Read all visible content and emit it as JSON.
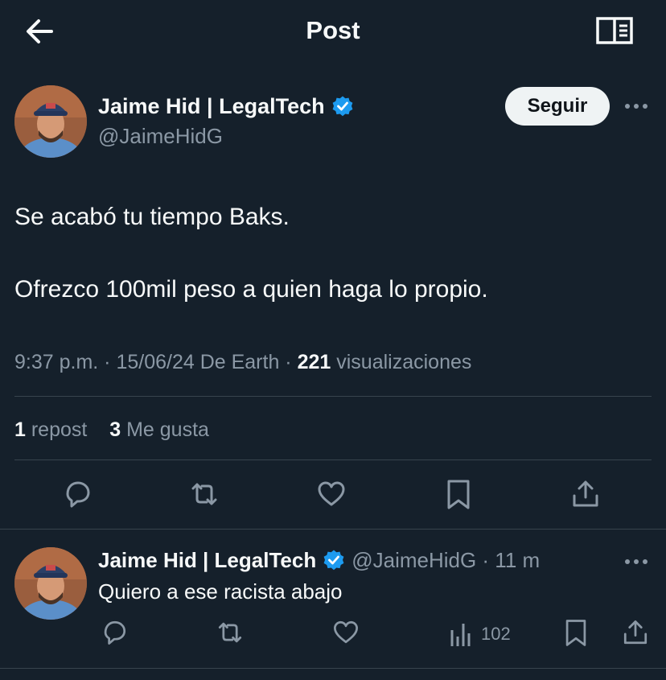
{
  "header": {
    "title": "Post",
    "back_icon": "arrow-left-icon",
    "reader_icon": "open-book-icon"
  },
  "tweet": {
    "author_name": "Jaime Hid | LegalTech",
    "author_handle": "@JaimeHidG",
    "verified_color": "#1d9bf0",
    "follow_label": "Seguir",
    "text_line1": "Se acabó tu tiempo Baks.",
    "text_line2": "Ofrezco 100mil peso a quien haga lo propio.",
    "time": "9:37 p.m. · 15/06/24 De Earth · ",
    "views": "221",
    "views_label": " visualizaciones",
    "reposts": "1",
    "reposts_label": " repost",
    "likes": "3",
    "likes_label": " Me gusta"
  },
  "reply": {
    "author_name": "Jaime Hid | LegalTech",
    "handle_time": "@JaimeHidG · 11 m",
    "text": "Quiero a ese racista abajo",
    "views": "102"
  },
  "colors": {
    "background": "#15202b",
    "text": "#f7f9f9",
    "muted": "#8b98a5",
    "divider": "#38444d"
  }
}
